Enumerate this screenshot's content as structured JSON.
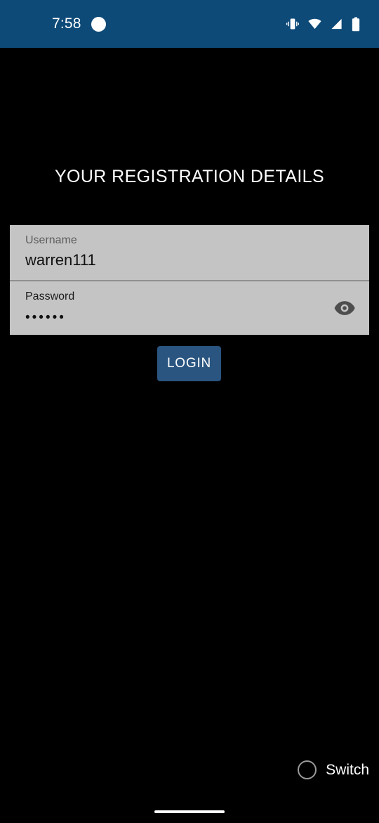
{
  "status_bar": {
    "background_color": "#0d4a78",
    "time": "7:58",
    "notification_indicator": "notification-dot-icon",
    "icons": [
      {
        "name": "vibrate-icon",
        "label": "Vibrate mode"
      },
      {
        "name": "wifi-icon",
        "label": "Wi-Fi"
      },
      {
        "name": "cellular-signal-icon",
        "label": "Mobile signal"
      },
      {
        "name": "battery-icon",
        "label": "Battery"
      }
    ]
  },
  "screen": {
    "background_color": "#000000",
    "title": "YOUR REGISTRATION DETAILS"
  },
  "form": {
    "background_color": "#c4c4c4",
    "username": {
      "label": "Username",
      "value": "warren111",
      "placeholder": "Username"
    },
    "password": {
      "label": "Password",
      "value": "••••••",
      "placeholder": "Password",
      "masked": true,
      "character_count": 6,
      "toggle_icon": "eye-icon"
    }
  },
  "login_button": {
    "label": "LOGIN",
    "color": "#2a5580",
    "text_color": "#ffffff"
  },
  "switch_control": {
    "label": "Switch",
    "selected": false,
    "icon": "radio-circle-icon"
  },
  "navigation": {
    "gesture_bar": "home-indicator"
  }
}
